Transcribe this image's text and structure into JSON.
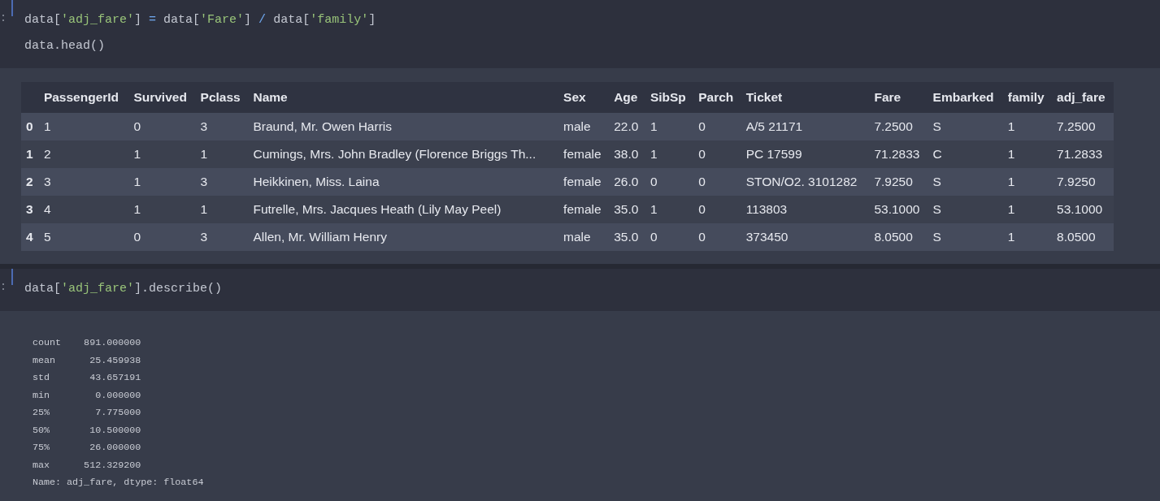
{
  "cells": [
    {
      "input": {
        "lines": [
          [
            {
              "kind": "plain",
              "text": "data["
            },
            {
              "kind": "string",
              "text": "'adj_fare'"
            },
            {
              "kind": "plain",
              "text": "] "
            },
            {
              "kind": "operator",
              "text": "="
            },
            {
              "kind": "plain",
              "text": " data["
            },
            {
              "kind": "string",
              "text": "'Fare'"
            },
            {
              "kind": "plain",
              "text": "] "
            },
            {
              "kind": "operator",
              "text": "/"
            },
            {
              "kind": "plain",
              "text": " data["
            },
            {
              "kind": "string",
              "text": "'family'"
            },
            {
              "kind": "plain",
              "text": "]"
            }
          ],
          [
            {
              "kind": "plain",
              "text": "data.head()"
            }
          ]
        ]
      },
      "output": {
        "kind": "table",
        "columns": [
          "",
          "PassengerId",
          "Survived",
          "Pclass",
          "Name",
          "Sex",
          "Age",
          "SibSp",
          "Parch",
          "Ticket",
          "Fare",
          "Embarked",
          "family",
          "adj_fare"
        ],
        "rows": [
          [
            "0",
            "1",
            "0",
            "3",
            "Braund, Mr. Owen Harris",
            "male",
            "22.0",
            "1",
            "0",
            "A/5 21171",
            "7.2500",
            "S",
            "1",
            "7.2500"
          ],
          [
            "1",
            "2",
            "1",
            "1",
            "Cumings, Mrs. John Bradley (Florence Briggs Th...",
            "female",
            "38.0",
            "1",
            "0",
            "PC 17599",
            "71.2833",
            "C",
            "1",
            "71.2833"
          ],
          [
            "2",
            "3",
            "1",
            "3",
            "Heikkinen, Miss. Laina",
            "female",
            "26.0",
            "0",
            "0",
            "STON/O2. 3101282",
            "7.9250",
            "S",
            "1",
            "7.9250"
          ],
          [
            "3",
            "4",
            "1",
            "1",
            "Futrelle, Mrs. Jacques Heath (Lily May Peel)",
            "female",
            "35.0",
            "1",
            "0",
            "113803",
            "53.1000",
            "S",
            "1",
            "53.1000"
          ],
          [
            "4",
            "5",
            "0",
            "3",
            "Allen, Mr. William Henry",
            "male",
            "35.0",
            "0",
            "0",
            "373450",
            "8.0500",
            "S",
            "1",
            "8.0500"
          ]
        ]
      }
    },
    {
      "input": {
        "lines": [
          [
            {
              "kind": "plain",
              "text": "data["
            },
            {
              "kind": "string",
              "text": "'adj_fare'"
            },
            {
              "kind": "plain",
              "text": "].describe()"
            }
          ]
        ]
      },
      "output": {
        "kind": "text",
        "lines": [
          "count    891.000000",
          "mean      25.459938",
          "std       43.657191",
          "min        0.000000",
          "25%        7.775000",
          "50%       10.500000",
          "75%       26.000000",
          "max      512.329200",
          "Name: adj_fare, dtype: float64"
        ]
      }
    }
  ]
}
